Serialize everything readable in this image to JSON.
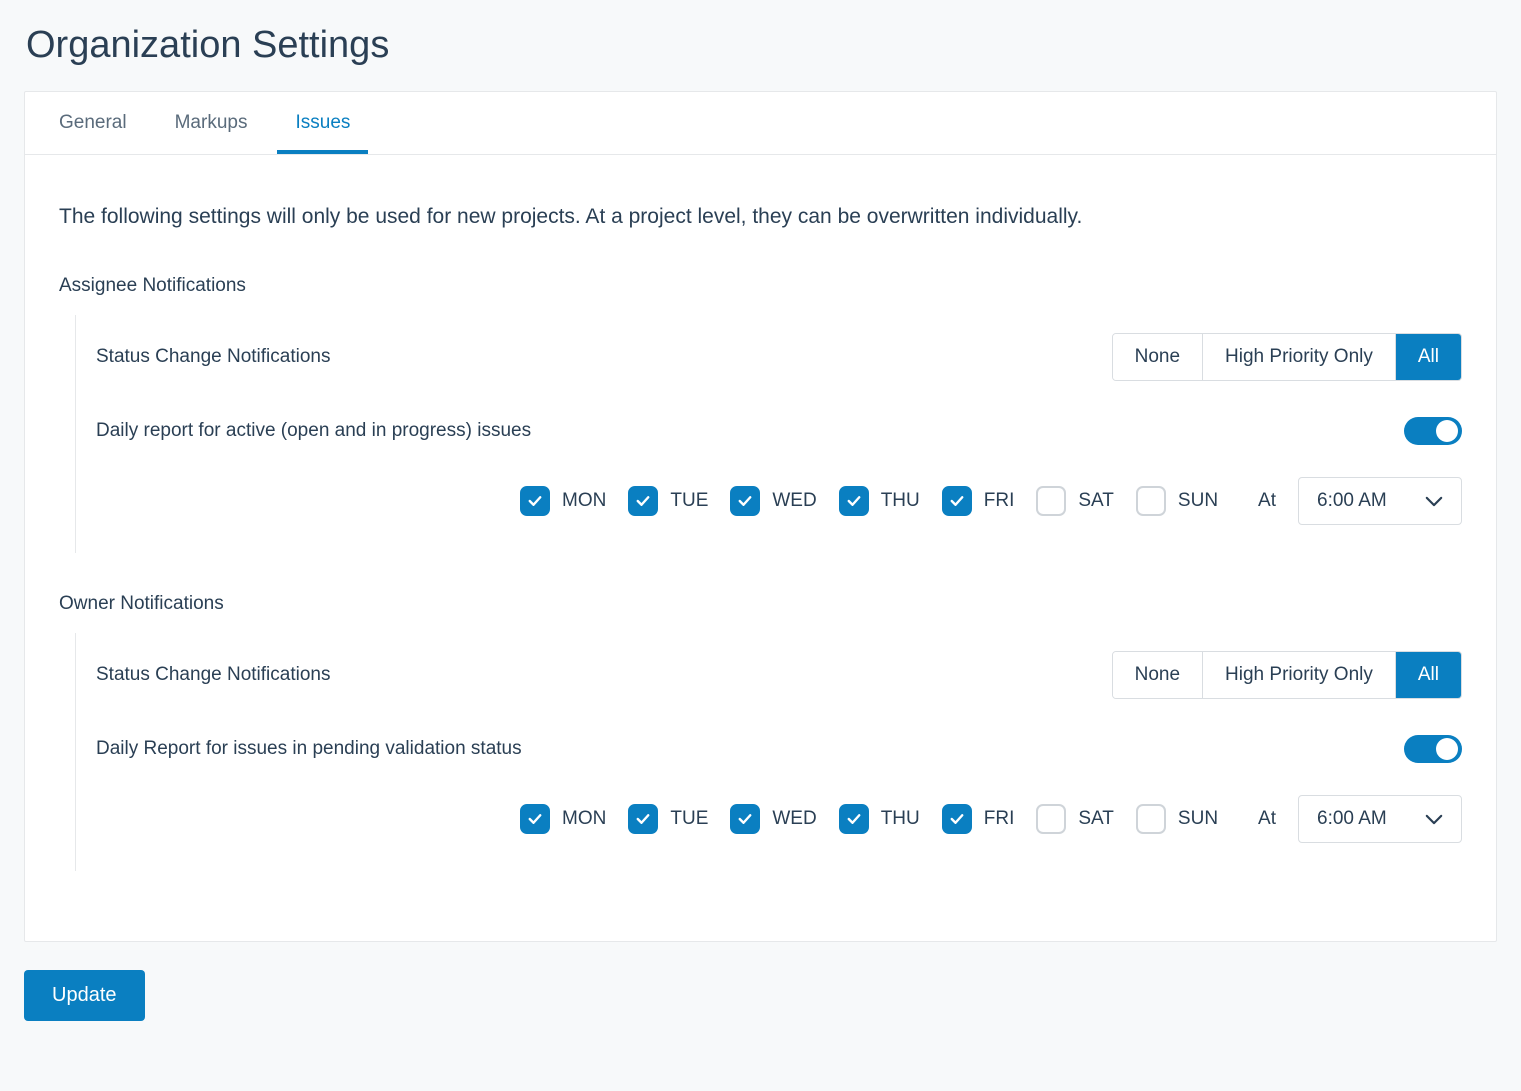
{
  "page": {
    "title": "Organization Settings"
  },
  "tabs": [
    {
      "label": "General",
      "active": false
    },
    {
      "label": "Markups",
      "active": false
    },
    {
      "label": "Issues",
      "active": true
    }
  ],
  "intro": "The following settings will only be used for new projects. At a project level, they can be overwritten individually.",
  "segments": {
    "none": "None",
    "high": "High Priority Only",
    "all": "All"
  },
  "assignee": {
    "title": "Assignee Notifications",
    "status_label": "Status Change Notifications",
    "status_selected": "all",
    "daily_label": "Daily report for active (open and in progress) issues",
    "daily_enabled": true,
    "days": [
      {
        "label": "MON",
        "checked": true
      },
      {
        "label": "TUE",
        "checked": true
      },
      {
        "label": "WED",
        "checked": true
      },
      {
        "label": "THU",
        "checked": true
      },
      {
        "label": "FRI",
        "checked": true
      },
      {
        "label": "SAT",
        "checked": false
      },
      {
        "label": "SUN",
        "checked": false
      }
    ],
    "at_label": "At",
    "time": "6:00 AM"
  },
  "owner": {
    "title": "Owner Notifications",
    "status_label": "Status Change Notifications",
    "status_selected": "all",
    "daily_label": "Daily Report for issues in pending validation status",
    "daily_enabled": true,
    "days": [
      {
        "label": "MON",
        "checked": true
      },
      {
        "label": "TUE",
        "checked": true
      },
      {
        "label": "WED",
        "checked": true
      },
      {
        "label": "THU",
        "checked": true
      },
      {
        "label": "FRI",
        "checked": true
      },
      {
        "label": "SAT",
        "checked": false
      },
      {
        "label": "SUN",
        "checked": false
      }
    ],
    "at_label": "At",
    "time": "6:00 AM"
  },
  "update_label": "Update"
}
